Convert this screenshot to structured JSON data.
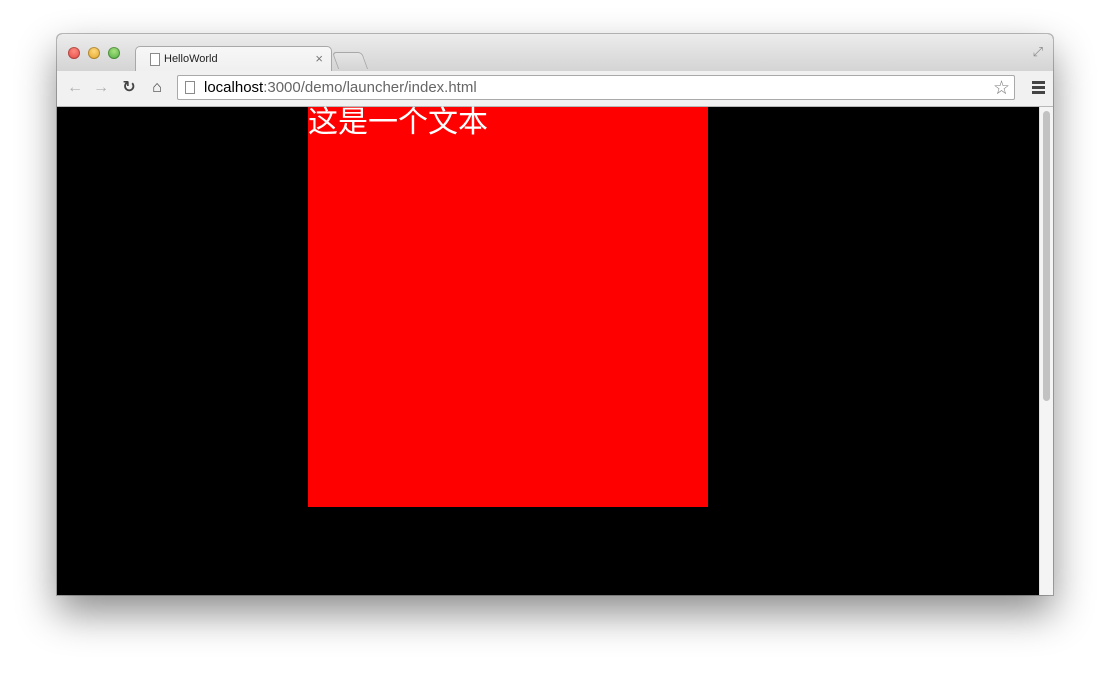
{
  "browser": {
    "tab": {
      "title": "HelloWorld",
      "close_glyph": "×"
    },
    "address_bar": {
      "url_host": "localhost",
      "url_rest": ":3000/demo/launcher/index.html"
    },
    "icons": {
      "back": "←",
      "forward": "→",
      "reload": "↻",
      "home": "⌂",
      "bookmark_star": "☆",
      "fullscreen": "⤢"
    }
  },
  "page": {
    "background": "#000000",
    "box": {
      "color": "#ff0000",
      "text": "这是一个文本",
      "text_color": "#ffffff"
    }
  }
}
